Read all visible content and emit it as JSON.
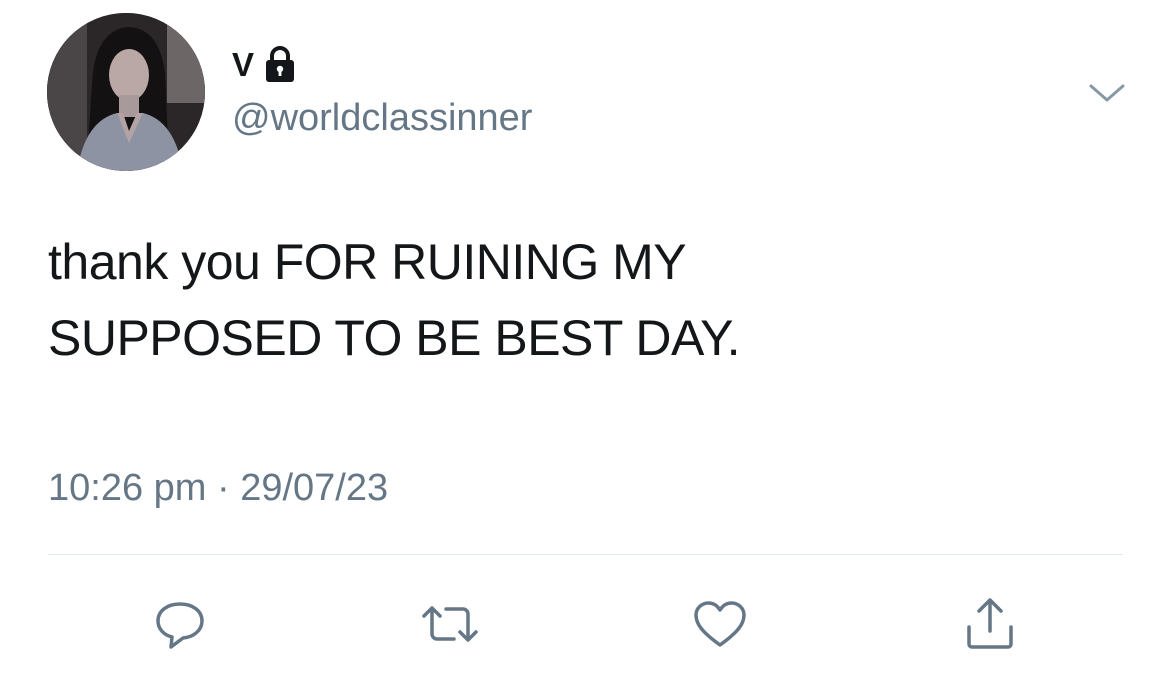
{
  "user": {
    "display_name": "V",
    "handle": "@worldclassinner",
    "protected_icon": "lock-icon",
    "avatar": "profile-photo"
  },
  "tweet": {
    "text_lines": [
      "thank you FOR RUINING MY",
      "SUPPOSED TO BE BEST DAY."
    ],
    "timestamp": "10:26 pm · 29/07/23"
  },
  "actions": [
    {
      "name": "reply",
      "icon": "reply-icon"
    },
    {
      "name": "retweet",
      "icon": "retweet-icon"
    },
    {
      "name": "like",
      "icon": "heart-icon"
    },
    {
      "name": "share",
      "icon": "share-icon"
    }
  ],
  "menu_icon": "chevron-down-icon",
  "colors": {
    "text": "#14171a",
    "secondary": "#657786",
    "divider": "#e1e8ed",
    "background": "#ffffff"
  }
}
